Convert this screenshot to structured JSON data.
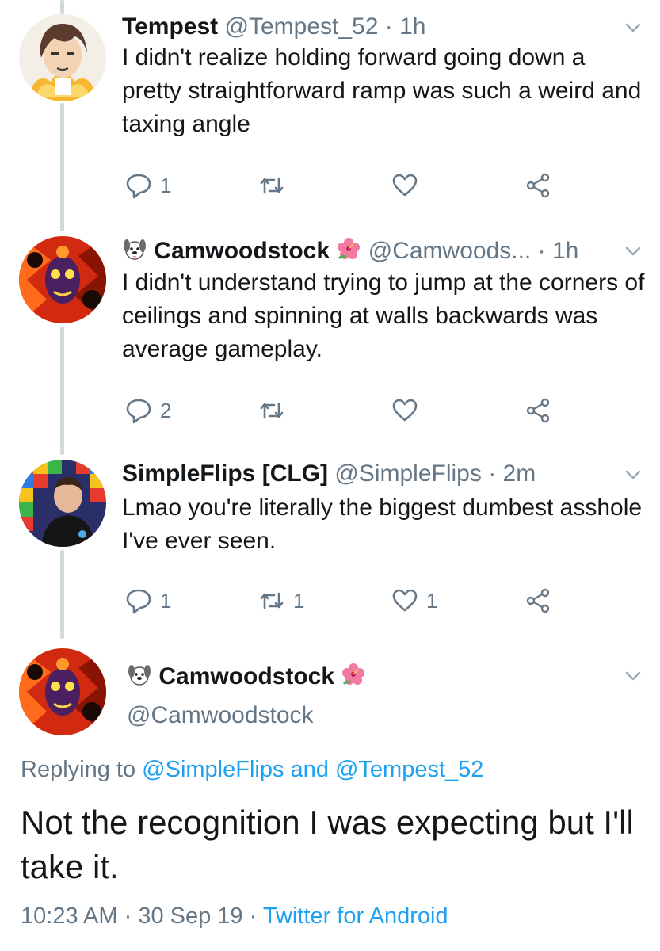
{
  "tweets": [
    {
      "name": "Tempest",
      "handle": "@Tempest_52",
      "time": "1h",
      "separator": "·",
      "text": "I didn't realize holding forward going down a pretty straightforward ramp was such a weird and taxing angle",
      "reply_count": "1",
      "retweet_count": "",
      "like_count": ""
    },
    {
      "name": "Camwoodstock",
      "handle": "@Camwoods...",
      "time": "1h",
      "separator": "·",
      "text": "I didn't understand trying to jump at the corners of ceilings and spinning at walls backwards was average gameplay.",
      "reply_count": "2",
      "retweet_count": "",
      "like_count": ""
    },
    {
      "name": "SimpleFlips [CLG]",
      "handle": "@SimpleFlips",
      "time": "2m",
      "separator": "·",
      "text": "Lmao you're literally the biggest dumbest asshole I've ever seen.",
      "reply_count": "1",
      "retweet_count": "1",
      "like_count": "1"
    }
  ],
  "main_tweet": {
    "name": "Camwoodstock",
    "handle": "@Camwoodstock",
    "replying_prefix": "Replying to",
    "replying_user_1": "@SimpleFlips",
    "replying_and": "and",
    "replying_user_2": "@Tempest_52",
    "text": "Not the recognition I was expecting but I'll take it.",
    "time": "10:23 AM",
    "date": "30 Sep 19",
    "separator": "·",
    "source": "Twitter for Android"
  },
  "icons": {
    "reply": "reply-icon",
    "retweet": "retweet-icon",
    "like": "heart-icon",
    "share": "share-icon",
    "more": "chevron-down-icon",
    "name_prefix": "dog-emoji-icon",
    "name_suffix": "hibiscus-emoji-icon"
  },
  "colors": {
    "link": "#1da1f2",
    "secondary_text": "#657786",
    "primary_text": "#14171a",
    "thread_line": "#cfd9de"
  }
}
